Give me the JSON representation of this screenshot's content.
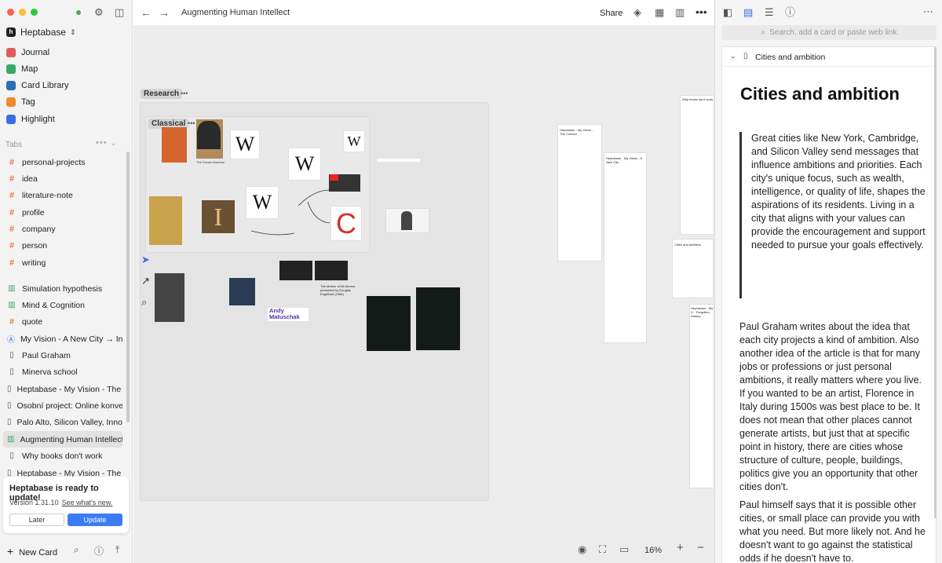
{
  "window": {
    "title": "Augmenting Human Intellect"
  },
  "workspace": {
    "name": "Heptabase"
  },
  "nav": [
    {
      "label": "Journal",
      "color": "#e05d5d",
      "icon": "journal-icon"
    },
    {
      "label": "Map",
      "color": "#3aa66a",
      "icon": "map-icon"
    },
    {
      "label": "Card Library",
      "color": "#2d6fb8",
      "icon": "card-library-icon"
    },
    {
      "label": "Tag",
      "color": "#ee8a2c",
      "icon": "tag-icon"
    },
    {
      "label": "Highlight",
      "color": "#3b6fe0",
      "icon": "highlight-icon"
    }
  ],
  "tabs_section": {
    "label": "Tabs"
  },
  "tabs": [
    {
      "label": "personal-projects",
      "kind": "tag"
    },
    {
      "label": "idea",
      "kind": "tag"
    },
    {
      "label": "literature-note",
      "kind": "tag"
    },
    {
      "label": "profile",
      "kind": "tag"
    },
    {
      "label": "company",
      "kind": "tag"
    },
    {
      "label": "person",
      "kind": "tag"
    },
    {
      "label": "writing",
      "kind": "tag"
    },
    {
      "label": "Simulation hypothesis",
      "kind": "map"
    },
    {
      "label": "Mind & Cognition",
      "kind": "map"
    },
    {
      "label": "quote",
      "kind": "tag"
    },
    {
      "label": "My Vision - A New City → In Pa...",
      "kind": "mention"
    },
    {
      "label": "Paul Graham",
      "kind": "card"
    },
    {
      "label": "Minerva school",
      "kind": "card"
    },
    {
      "label": "Heptabase - My Vision - The C...",
      "kind": "card"
    },
    {
      "label": "Osobní project: Online konverto...",
      "kind": "card"
    },
    {
      "label": "Palo Alto, Silicon Valley, Innova...",
      "kind": "card"
    },
    {
      "label": "Augmenting Human Intellect",
      "kind": "map",
      "active": true
    },
    {
      "label": "Why books don't work",
      "kind": "card"
    },
    {
      "label": "Heptabase - My Vision - The K...",
      "kind": "card"
    }
  ],
  "update": {
    "title": "Heptabase is ready to update!",
    "version": "Version 1.31.10",
    "link": "See what's new.",
    "later": "Later",
    "update": "Update"
  },
  "footer": {
    "new_card": "New Card"
  },
  "toolbar": {
    "share": "Share",
    "zoom": "16%"
  },
  "canvas": {
    "section_research": "Research",
    "section_classical": "Classical",
    "sidecards": [
      "Why books don't work",
      "Heptabase - My Vision - The Context",
      "Heptabase - My Vision - A New City",
      "Cities and ambition",
      "Heptabase - My V... Forgotten History"
    ],
    "book_cards": [
      "The Dream Machine",
      "The Mother of All Demos, presented by Douglas Engelbart (1968)",
      "Andy Matuschak"
    ]
  },
  "panel": {
    "search_placeholder": "Search, add a card or paste web link",
    "card_title": "Cities and ambition",
    "heading": "Cities and ambition",
    "quote": "Great cities like New York, Cambridge, and Silicon Valley send messages that influence ambitions and priorities. Each city's unique focus, such as wealth, intelligence, or quality of life, shapes the aspirations of its residents. Living in a city that aligns with your values can provide the encouragement and support needed to pursue your goals effectively.",
    "p1": "Paul Graham writes about the idea that each city projects a kind of ambition. Also another idea of the article is that for many jobs or professions or just personal ambitions, it really matters where you live. If you wanted to be an artist, Florence in Italy during 1500s was best place to be. It does not mean that other places cannot generate artists, but just that at specific point in history, there are cities whose structure of culture, people, buildings, politics give you an opportunity that other cities don't.",
    "p2": "Paul himself says that it is possible other cities, or small place can provide you with what you need. But more likely not. And he doesn't want to go against the statistical odds if he doesn't have to."
  }
}
